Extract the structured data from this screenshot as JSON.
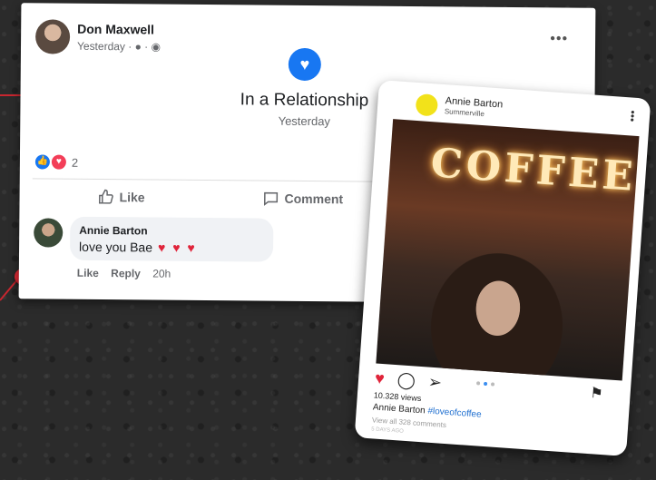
{
  "facebook_post": {
    "author": "Don Maxwell",
    "time": "Yesterday · ● · ◉",
    "more": "•••",
    "life_event": {
      "title": "In a Relationship",
      "date": "Yesterday"
    },
    "reaction_count": "2",
    "like_label": "Like",
    "comment_label": "Comment",
    "comment": {
      "author": "Annie Barton",
      "text": "love you Bae",
      "hearts": "♥ ♥ ♥",
      "like": "Like",
      "reply": "Reply",
      "time": "20h"
    }
  },
  "instagram_post": {
    "user": "Annie Barton",
    "location": "Summerville",
    "sign_text": "COFFEE",
    "views": "10.328 views",
    "caption_user": "Annie Barton",
    "caption_tag": "#loveofcoffee",
    "comments_link": "View all 328 comments",
    "time_ago": "5 DAYS AGO"
  },
  "colors": {
    "pin": "#e02a35",
    "fb_blue": "#1877f2",
    "heart_red": "#e0243a"
  }
}
